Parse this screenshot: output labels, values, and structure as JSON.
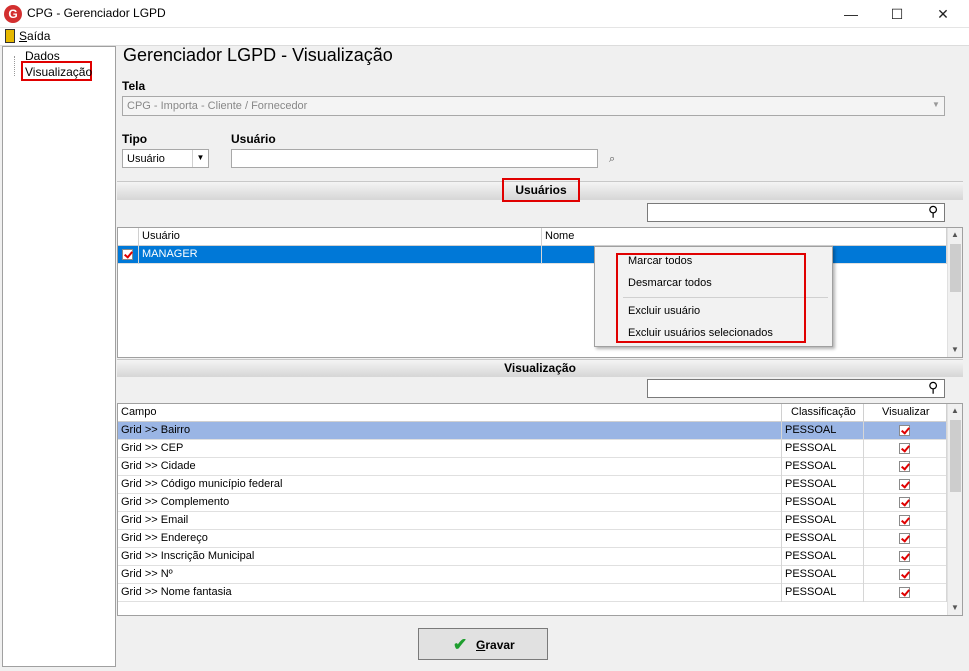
{
  "window": {
    "title": "CPG - Gerenciador LGPD",
    "app_icon": "G",
    "minimize": "—",
    "maximize": "☐",
    "close": "✕"
  },
  "menu": {
    "exit_label": "Saída"
  },
  "tree": {
    "items": [
      "Dados",
      "Visualização"
    ]
  },
  "page": {
    "heading": "Gerenciador LGPD - Visualização",
    "tela_label": "Tela",
    "tela_value": "CPG - Importa - Cliente / Fornecedor",
    "tipo_label": "Tipo",
    "tipo_value": "Usuário",
    "usuario_label": "Usuário",
    "usuario_value": ""
  },
  "usuarios_section": {
    "title": "Usuários",
    "search_value": "",
    "columns": [
      "Usuário",
      "Nome"
    ],
    "rows": [
      {
        "usuario": "MANAGER",
        "nome": "",
        "checked": true
      }
    ]
  },
  "context_menu": {
    "items": [
      "Marcar todos",
      "Desmarcar todos",
      "Excluir usuário",
      "Excluir usuários selecionados"
    ]
  },
  "visualizacao_section": {
    "title": "Visualização",
    "search_value": "",
    "columns": [
      "Campo",
      "Classificação",
      "Visualizar"
    ],
    "rows": [
      {
        "campo": "Grid >> Bairro",
        "classificacao": "PESSOAL",
        "visualizar": true
      },
      {
        "campo": "Grid >> CEP",
        "classificacao": "PESSOAL",
        "visualizar": true
      },
      {
        "campo": "Grid >> Cidade",
        "classificacao": "PESSOAL",
        "visualizar": true
      },
      {
        "campo": "Grid >> Código município federal",
        "classificacao": "PESSOAL",
        "visualizar": true
      },
      {
        "campo": "Grid >> Complemento",
        "classificacao": "PESSOAL",
        "visualizar": true
      },
      {
        "campo": "Grid >> Email",
        "classificacao": "PESSOAL",
        "visualizar": true
      },
      {
        "campo": "Grid >> Endereço",
        "classificacao": "PESSOAL",
        "visualizar": true
      },
      {
        "campo": "Grid >> Inscrição Municipal",
        "classificacao": "PESSOAL",
        "visualizar": true
      },
      {
        "campo": "Grid >> Nº",
        "classificacao": "PESSOAL",
        "visualizar": true
      },
      {
        "campo": "Grid >> Nome fantasia",
        "classificacao": "PESSOAL",
        "visualizar": true
      }
    ]
  },
  "footer": {
    "save_label": "Gravar"
  },
  "colors": {
    "selection_blue": "#0078d7",
    "row_highlight": "#9ab5e4",
    "highlight_red": "#e00000",
    "check_green": "#1e9e2e"
  }
}
